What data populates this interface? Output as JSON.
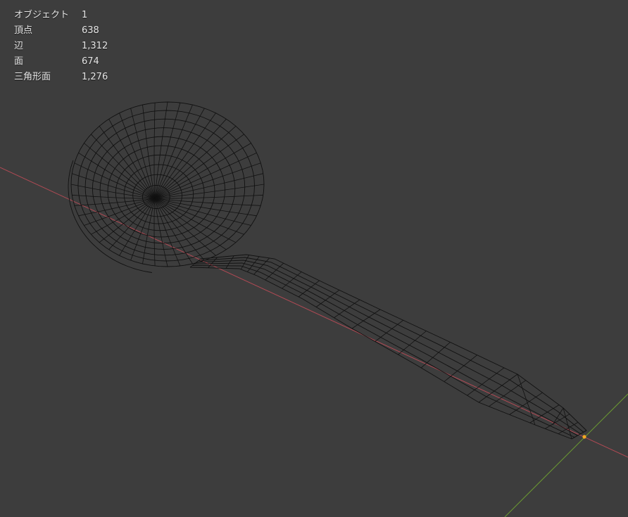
{
  "viewport": {
    "background": "#3d3d3d",
    "x_axis_color": "#b04a54",
    "y_axis_color": "#6b9a32",
    "wire_color": "#111111",
    "origin_color": "#f5a623"
  },
  "stats": [
    {
      "label": "オブジェクト",
      "value": "1"
    },
    {
      "label": "頂点",
      "value": "638"
    },
    {
      "label": "辺",
      "value": "1,312"
    },
    {
      "label": "面",
      "value": "674"
    },
    {
      "label": "三角形面",
      "value": "1,276"
    }
  ]
}
